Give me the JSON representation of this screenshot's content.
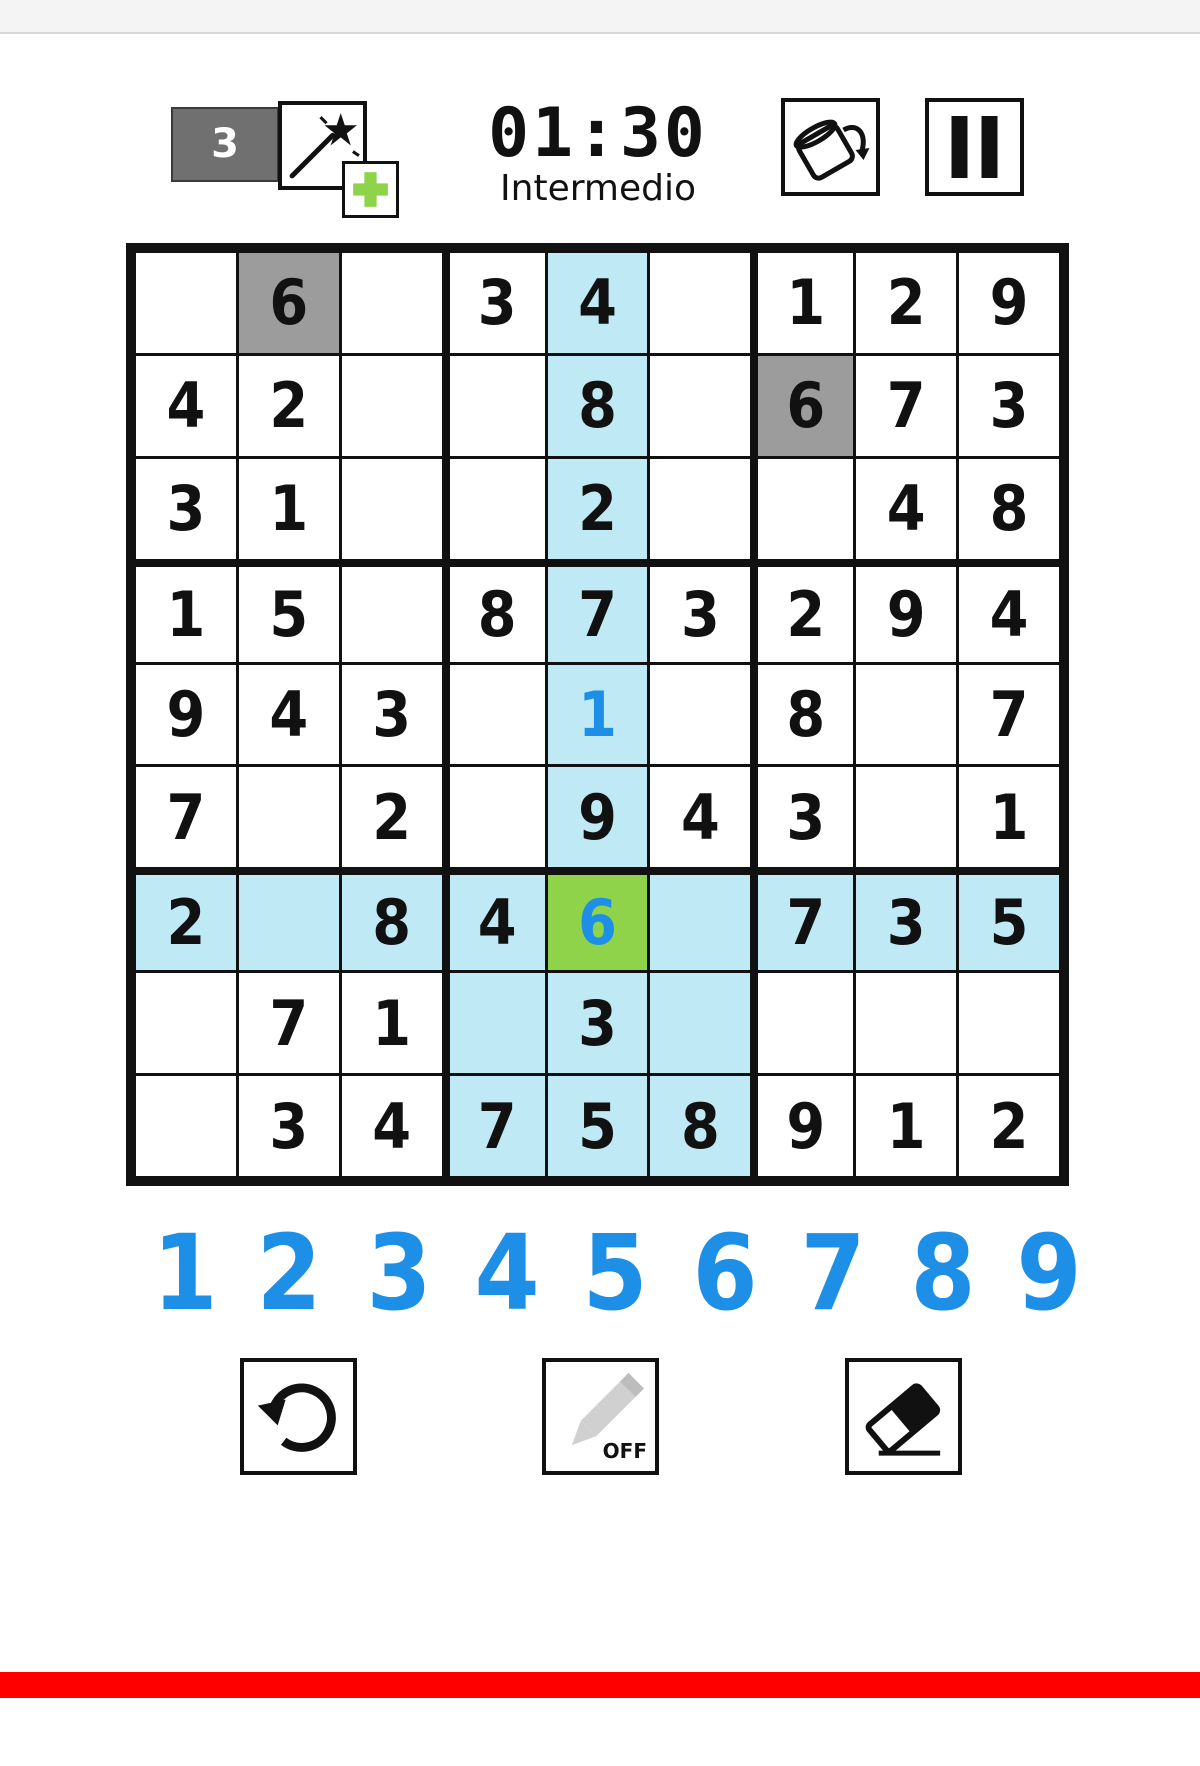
{
  "header": {
    "hints_count": "3",
    "timer": "01:30",
    "difficulty": "Intermedio"
  },
  "icons": {
    "hint": "magic-wand-icon",
    "add_hints": "plus-icon",
    "theme": "paint-bucket-icon",
    "pause": "pause-icon",
    "undo": "undo-icon",
    "notes": "pencil-icon",
    "erase": "eraser-icon"
  },
  "notes_toggle": {
    "state_label": "OFF"
  },
  "board": {
    "rows": [
      [
        "",
        "6",
        "",
        "3",
        "4",
        "",
        "1",
        "2",
        "9"
      ],
      [
        "4",
        "2",
        "",
        "",
        "8",
        "",
        "6",
        "7",
        "3"
      ],
      [
        "3",
        "1",
        "",
        "",
        "2",
        "",
        "",
        "4",
        "8"
      ],
      [
        "1",
        "5",
        "",
        "8",
        "7",
        "3",
        "2",
        "9",
        "4"
      ],
      [
        "9",
        "4",
        "3",
        "",
        "1",
        "",
        "8",
        "",
        "7"
      ],
      [
        "7",
        "",
        "2",
        "",
        "9",
        "4",
        "3",
        "",
        "1"
      ],
      [
        "2",
        "",
        "8",
        "4",
        "6",
        "",
        "7",
        "3",
        "5"
      ],
      [
        "",
        "7",
        "1",
        "",
        "3",
        "",
        "",
        "",
        ""
      ],
      [
        "",
        "3",
        "4",
        "7",
        "5",
        "8",
        "9",
        "1",
        "2"
      ]
    ],
    "selected_cell": {
      "row": 6,
      "col": 4
    },
    "user_entered_cells": [
      [
        4,
        4
      ],
      [
        6,
        4
      ]
    ],
    "grey_cells": [
      [
        0,
        1
      ],
      [
        1,
        6
      ]
    ]
  },
  "numpad": [
    "1",
    "2",
    "3",
    "4",
    "5",
    "6",
    "7",
    "8",
    "9"
  ],
  "colors": {
    "highlight": "#bfe9f5",
    "selected": "#8ed34a",
    "grey_given": "#9c9c9c",
    "user_digit": "#1e8fe6",
    "numpad_digit": "#1e8fe6",
    "bottom_bar": "#ff0000",
    "plus_green": "#8ed34a"
  }
}
